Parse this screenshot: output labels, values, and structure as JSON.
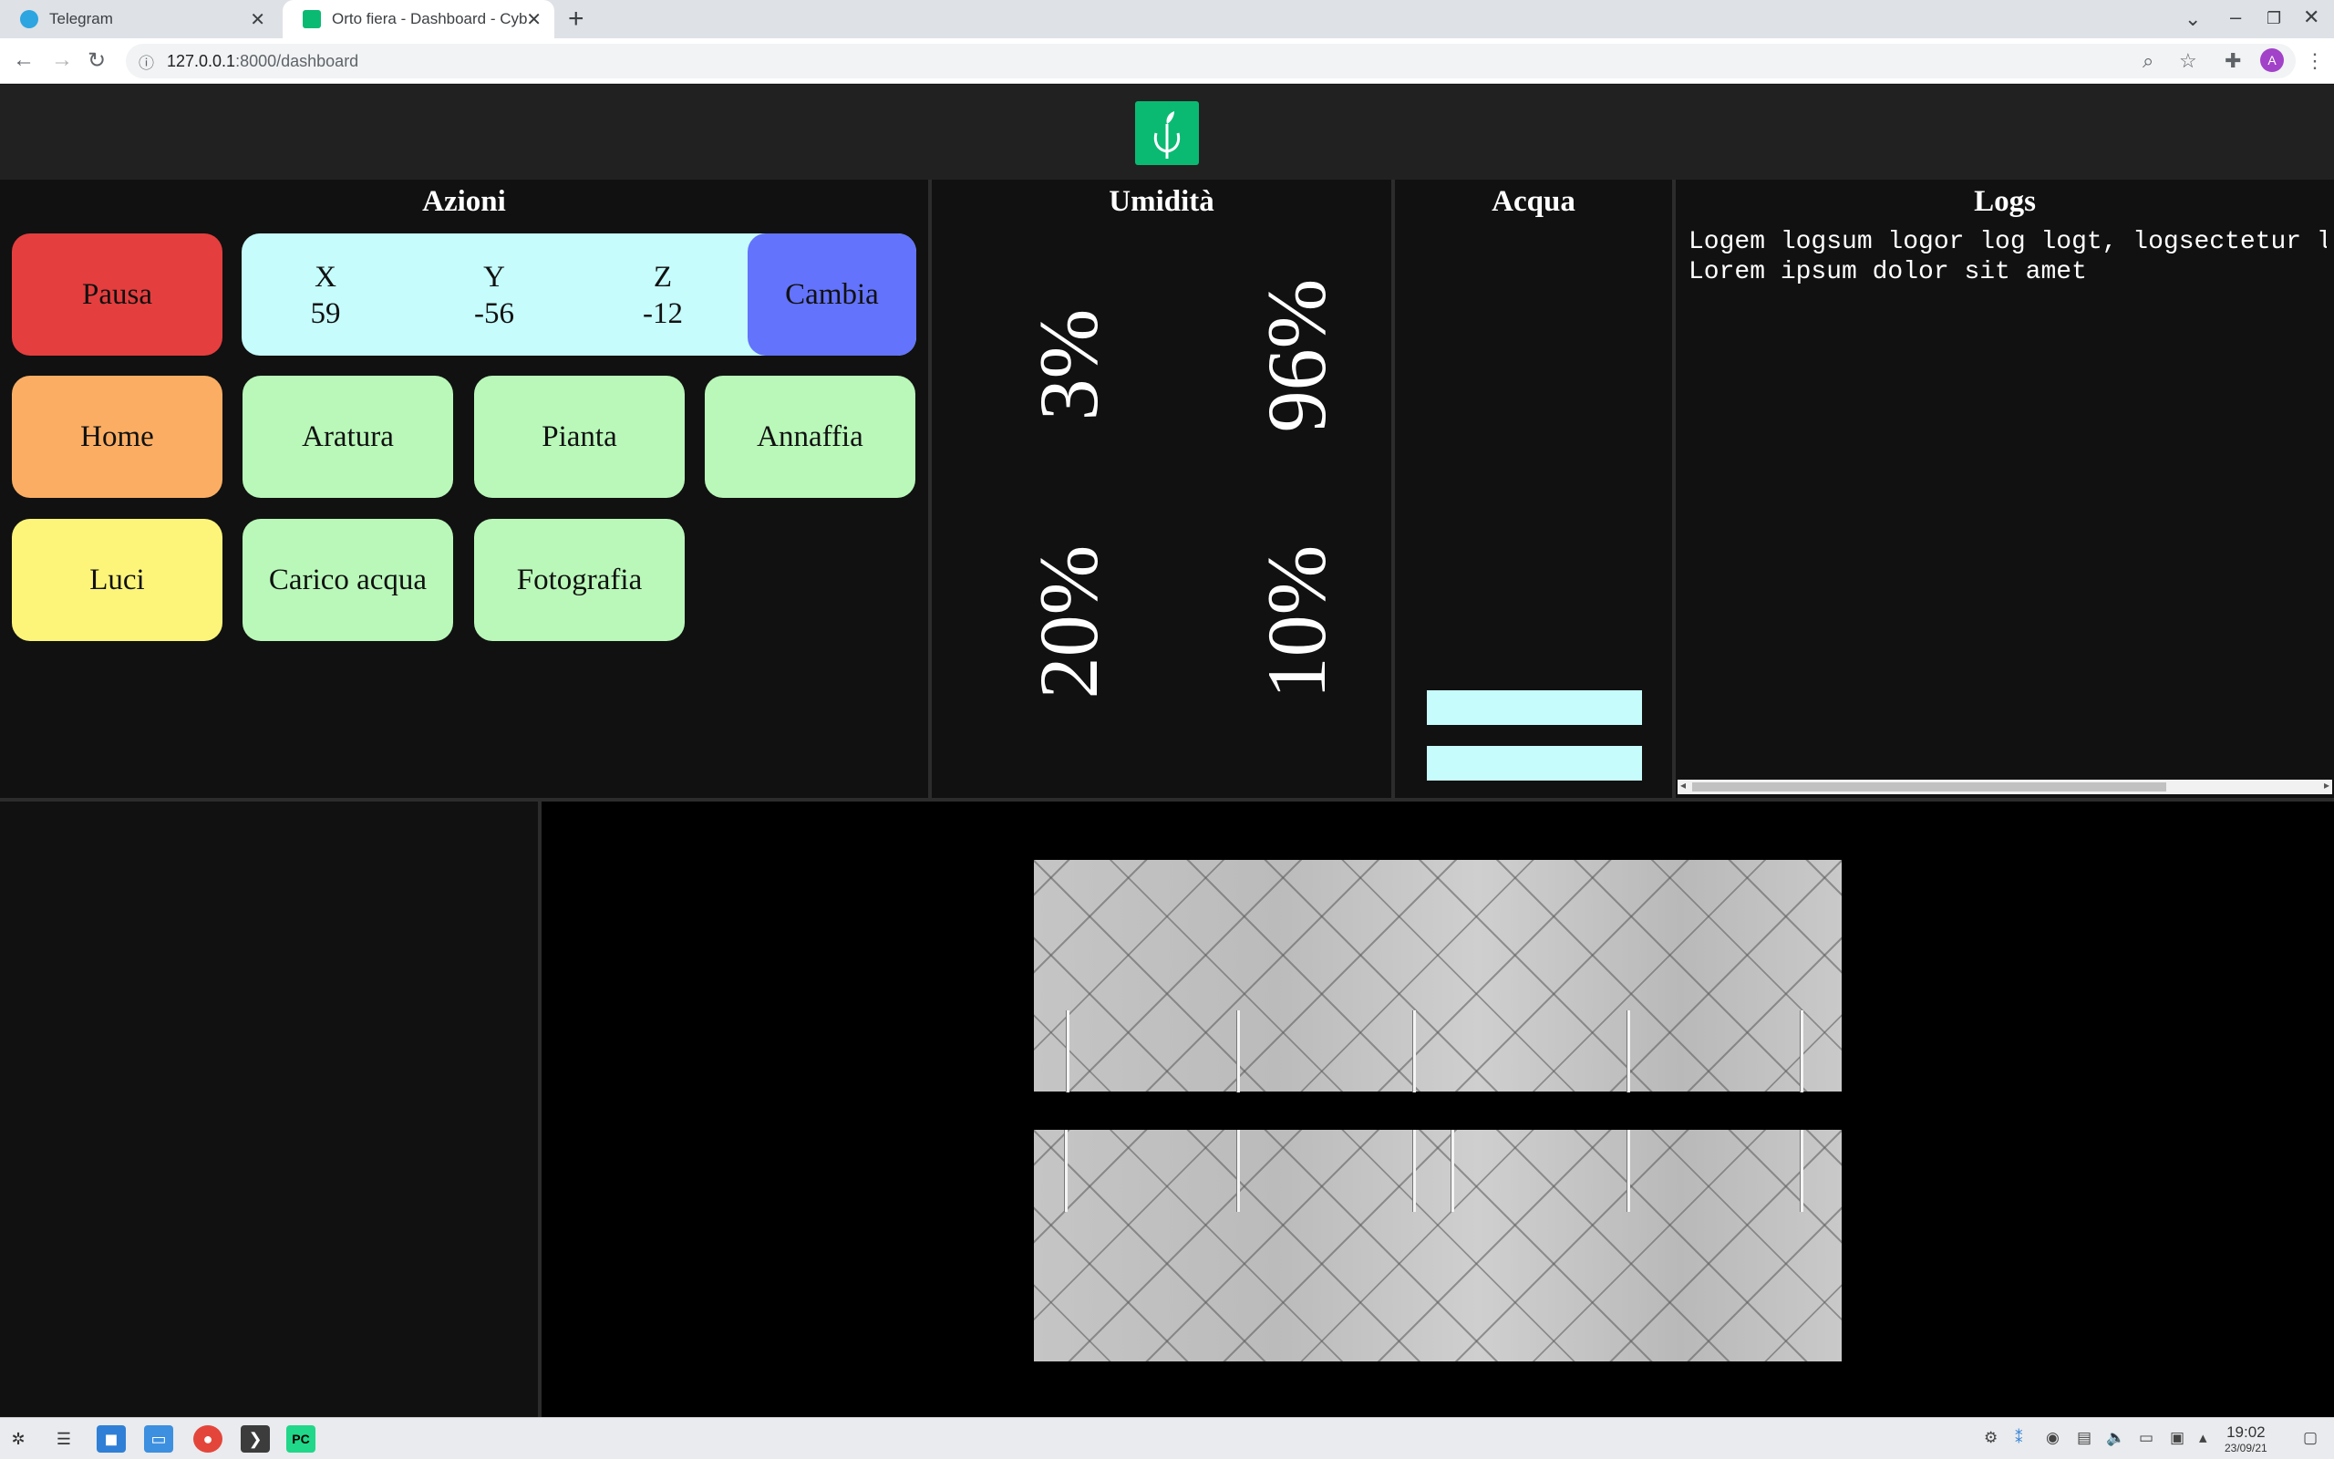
{
  "browser": {
    "tabs": [
      {
        "title": "Telegram",
        "icon": "telegram-icon",
        "color": "#2ca5e0"
      },
      {
        "title": "Orto fiera - Dashboard - Cyb",
        "icon": "plant-icon",
        "color": "#0aba73"
      }
    ],
    "url_host": "127.0.0.1",
    "url_path": ":8000/dashboard",
    "profile_initial": "A"
  },
  "dashboard": {
    "azioni": {
      "title": "Azioni",
      "pause_label": "Pausa",
      "home_label": "Home",
      "luci_label": "Luci",
      "aratura_label": "Aratura",
      "pianta_label": "Pianta",
      "annaffia_label": "Annaffia",
      "carico_label": "Carico acqua",
      "foto_label": "Fotografia",
      "cambia_label": "Cambia",
      "coords": {
        "x_label": "X",
        "x_value": "59",
        "y_label": "Y",
        "y_value": "-56",
        "z_label": "Z",
        "z_value": "-12"
      }
    },
    "umidita": {
      "title": "Umidità",
      "values": [
        "3%",
        "96%",
        "20%",
        "10%"
      ]
    },
    "acqua": {
      "title": "Acqua",
      "levels_shown": 2
    },
    "logs": {
      "title": "Logs",
      "lines": "Logem logsum logor log logt, logsectetur l\nLorem ipsum dolor sit amet"
    }
  },
  "colors": {
    "pause": "#e53e3e",
    "home": "#fbae63",
    "luci": "#fdf57a",
    "action": "#b9f8b9",
    "cambia": "#6373fb",
    "coords_bg": "#c6fcfc",
    "logo": "#0aba73"
  },
  "taskbar": {
    "time": "19:02",
    "date": "23/09/21"
  }
}
